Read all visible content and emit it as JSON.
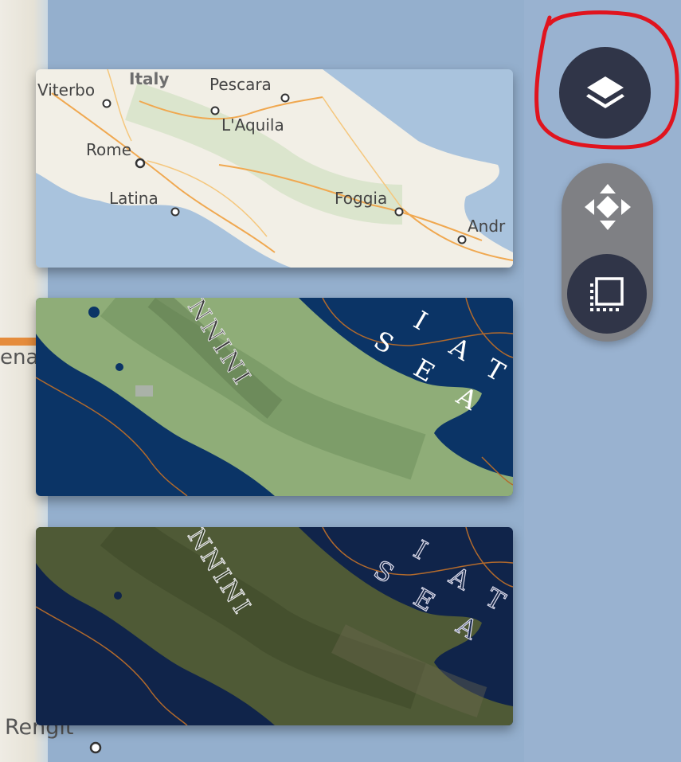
{
  "background": {
    "labels": [
      "ena",
      "Rengit"
    ]
  },
  "basemaps": [
    {
      "id": "streets",
      "labels": {
        "region": "Italy",
        "cities": [
          "Viterbo",
          "Pescara",
          "L'Aquila",
          "Rome",
          "Latina",
          "Foggia",
          "Andr"
        ]
      }
    },
    {
      "id": "topographic",
      "labels": {
        "mountains": "NNINI",
        "sea": [
          "I",
          "A",
          "T",
          "S",
          "E",
          "A"
        ]
      }
    },
    {
      "id": "imagery",
      "labels": {
        "mountains": "NNINI",
        "sea": [
          "I",
          "A",
          "T",
          "S",
          "E",
          "A"
        ]
      }
    }
  ],
  "toolbar": {
    "layers_icon": "layers-icon",
    "pan_icon": "move-arrows-icon",
    "select_icon": "selection-box-icon"
  },
  "colors": {
    "button_dark": "#303548",
    "button_group": "#7f8084",
    "highlight": "#e0141e",
    "sea_streets": "#a8c2dc",
    "sea_topo": "#0b3466",
    "sea_imagery": "#10244a"
  }
}
